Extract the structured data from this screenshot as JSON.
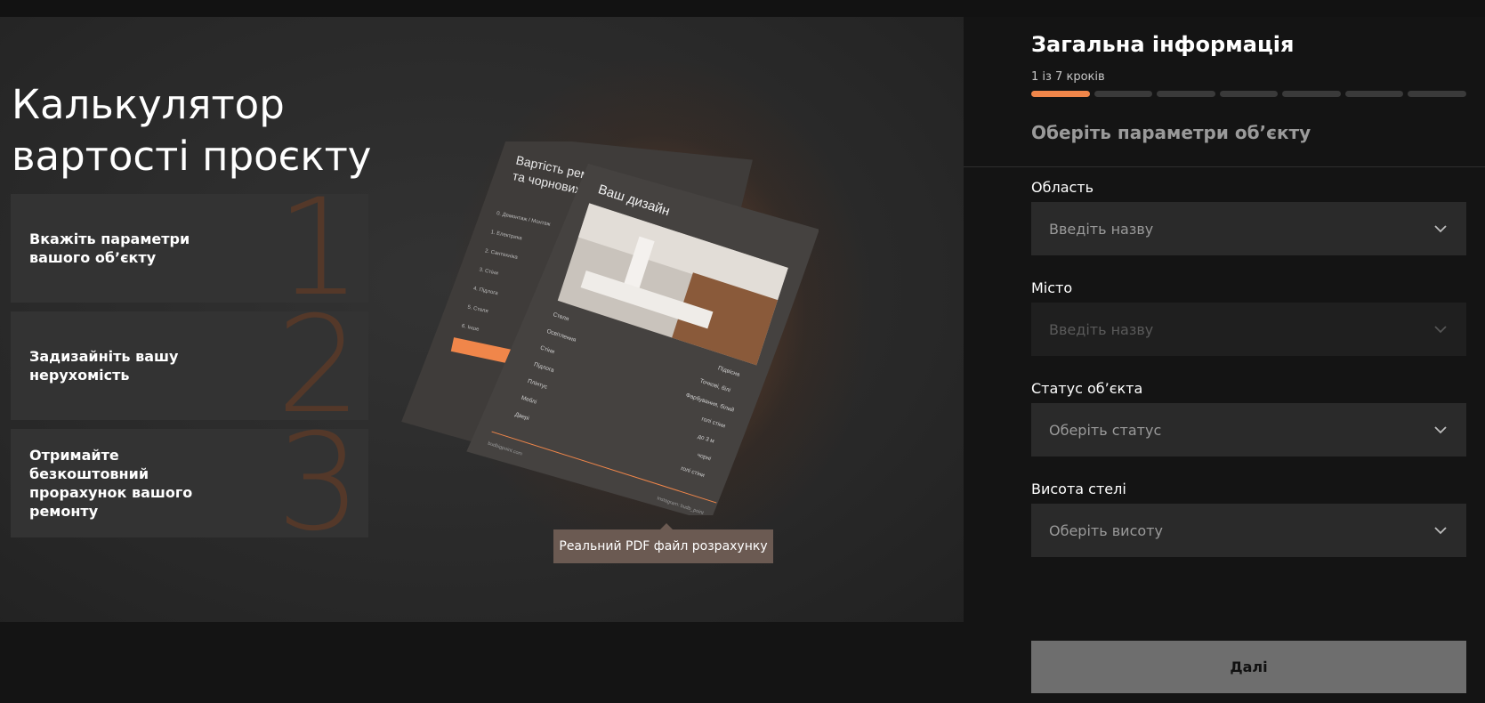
{
  "hero": {
    "title": "Калькулятор\nвартості проєкту",
    "steps": [
      {
        "num": "1",
        "label": "Вкажіть параметри\nвашого об’єкту"
      },
      {
        "num": "2",
        "label": "Задизайніть вашу\nнерухомість"
      },
      {
        "num": "3",
        "label": "Отримайте безкоштовний\nпрорахунок вашого ремонту"
      }
    ],
    "tooltip": "Реальний PDF файл розрахунку"
  },
  "pdf": {
    "back_title_1": "Вартість ремонтних робіт",
    "back_title_2": "та чорнових матеріалів",
    "back_items": [
      "0. Демонтаж / Монтаж",
      "1. Електрика",
      "2. Сантехніка",
      "3. Стіни",
      "4. Підлога",
      "5. Стеля",
      "6. Інше"
    ],
    "front_title": "Ваш дизайн",
    "front_rows": [
      {
        "left": "Стеля",
        "right": "Підвісна"
      },
      {
        "left": "Освітлення",
        "right": "Точкові, білі"
      },
      {
        "left": "Стіни",
        "right": "Фарбування, білий"
      },
      {
        "left": "Підлога",
        "right": "голі стіни"
      },
      {
        "left": "Плінтус",
        "right": "до 3 м"
      },
      {
        "left": "Меблі",
        "right": "чорні"
      },
      {
        "left": "Двері",
        "right": "голі стіни"
      }
    ],
    "footer_left": "budbigpoint.com",
    "footer_right": "Instagram: budb_point"
  },
  "panel": {
    "title": "Загальна інформація",
    "steps_text": "1 із 7 кроків",
    "progress": {
      "current": 1,
      "total": 7
    },
    "subtitle": "Оберіть параметри об’єкту",
    "fields": [
      {
        "label": "Область",
        "placeholder": "Введіть назву",
        "disabled": false
      },
      {
        "label": "Місто",
        "placeholder": "Введіть назву",
        "disabled": true
      },
      {
        "label": "Статус об’єкта",
        "placeholder": "Оберіть статус",
        "disabled": false
      },
      {
        "label": "Висота стелі",
        "placeholder": "Оберіть висоту",
        "disabled": false
      }
    ],
    "next_label": "Далі"
  },
  "colors": {
    "accent": "#f0864a",
    "panel_bg": "#141414",
    "field_bg": "#2a2a2a"
  }
}
